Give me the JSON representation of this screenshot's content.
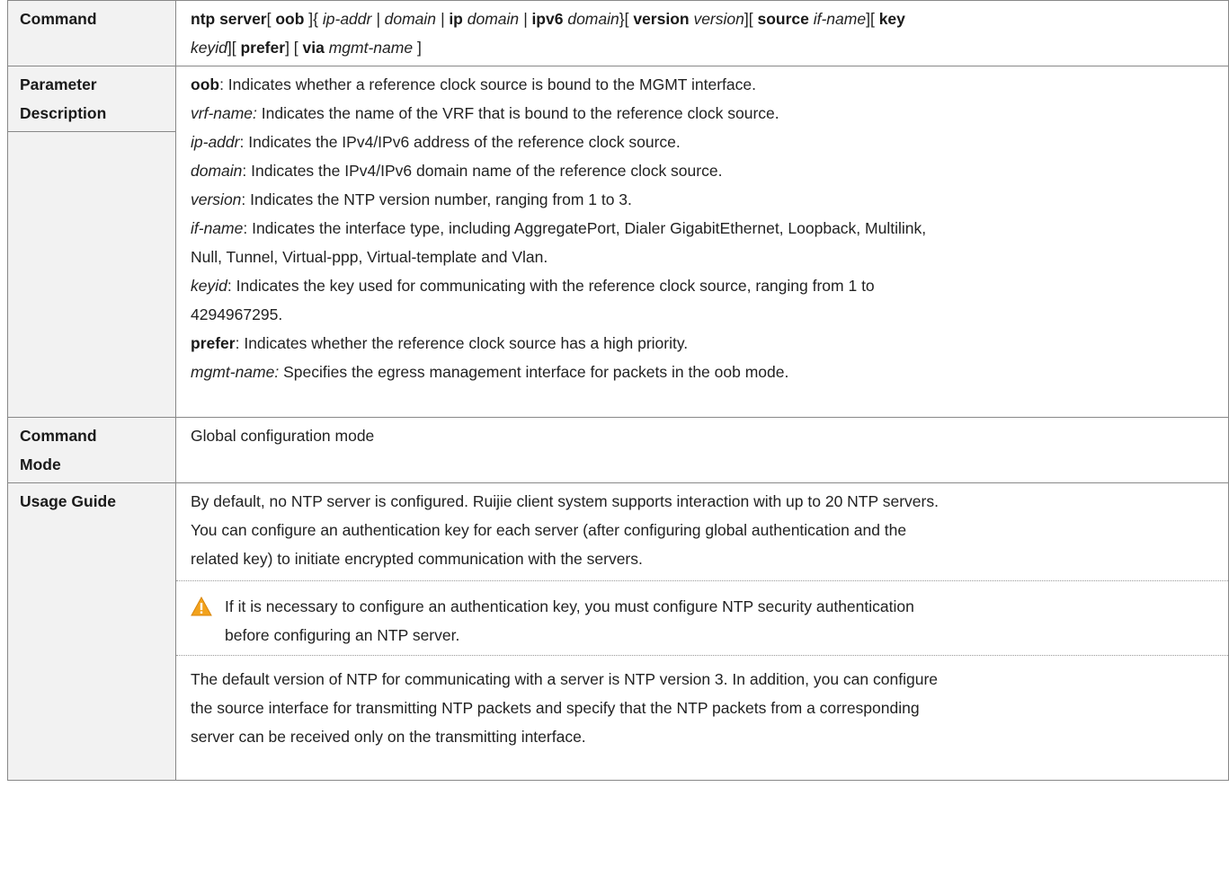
{
  "rows": {
    "command": {
      "label": "Command",
      "syntax": {
        "p1": "ntp server",
        "p2": "[ ",
        "p3": "oob",
        "p4": " ]{ ",
        "p5": "ip-addr | domain |",
        "p6": " ",
        "p7": "ip",
        "p8": " ",
        "p9": "domain |",
        "p10": " ",
        "p11": "ipv6",
        "p12": " ",
        "p13": "domain",
        "p14": "}[ ",
        "p15": "version",
        "p16": " ",
        "p17": "version",
        "p18": "][ ",
        "p19": "source",
        "p20": " ",
        "p21": "if-name",
        "p22": "][ ",
        "p23": "key",
        "p24": "keyid",
        "p25": "][ ",
        "p26": "prefer",
        "p27": "] [ ",
        "p28": "via",
        "p29": " ",
        "p30": "mgmt-name",
        "p31": " ]"
      }
    },
    "param": {
      "label_line1": "Parameter",
      "label_line2": "Description",
      "items": [
        {
          "term": "oob",
          "desc": ": Indicates whether a reference clock source is bound to the MGMT interface."
        },
        {
          "term": "vrf-name:",
          "desc": " Indicates the name of the VRF that is bound to the reference clock source."
        },
        {
          "term": "ip-addr",
          "desc": ": Indicates the IPv4/IPv6 address of the reference clock source."
        },
        {
          "term": "domain",
          "desc": ": Indicates the IPv4/IPv6 domain name of the reference clock source."
        },
        {
          "term": "version",
          "desc": ": Indicates the NTP version number, ranging from 1 to 3."
        },
        {
          "term": "if-name",
          "desc": ": Indicates the interface type, including AggregatePort, Dialer GigabitEthernet, Loopback, Multilink,",
          "desc2": "Null, Tunnel, Virtual-ppp, Virtual-template and Vlan."
        },
        {
          "term": "keyid",
          "desc": ": Indicates the key used for communicating with the reference clock source, ranging from 1 to",
          "desc2": "4294967295."
        },
        {
          "term": "prefer",
          "desc": ": Indicates whether the reference clock source has a high priority."
        },
        {
          "term": "mgmt-name:",
          "desc": " Specifies the egress management interface for packets in the oob mode."
        }
      ]
    },
    "mode": {
      "label_line1": "Command",
      "label_line2": "Mode",
      "value": "Global configuration mode"
    },
    "usage": {
      "label": "Usage Guide",
      "para1": [
        "By default, no NTP server is configured. Ruijie client system supports interaction with up to 20 NTP servers.",
        "You can configure an authentication key for each server (after configuring global authentication and the",
        "related key) to initiate encrypted communication with the servers."
      ],
      "note": [
        "If it is necessary to configure an authentication key, you must configure NTP security authentication",
        "before configuring an NTP server."
      ],
      "note_icon": "warning-triangle-icon",
      "note_icon_color": "#f2a21c",
      "para2": [
        "The default version of NTP for communicating with a server is NTP version 3. In addition, you can configure",
        "the source interface for transmitting NTP packets and specify that the NTP packets from a corresponding",
        "server can be received only on the transmitting interface."
      ]
    }
  }
}
